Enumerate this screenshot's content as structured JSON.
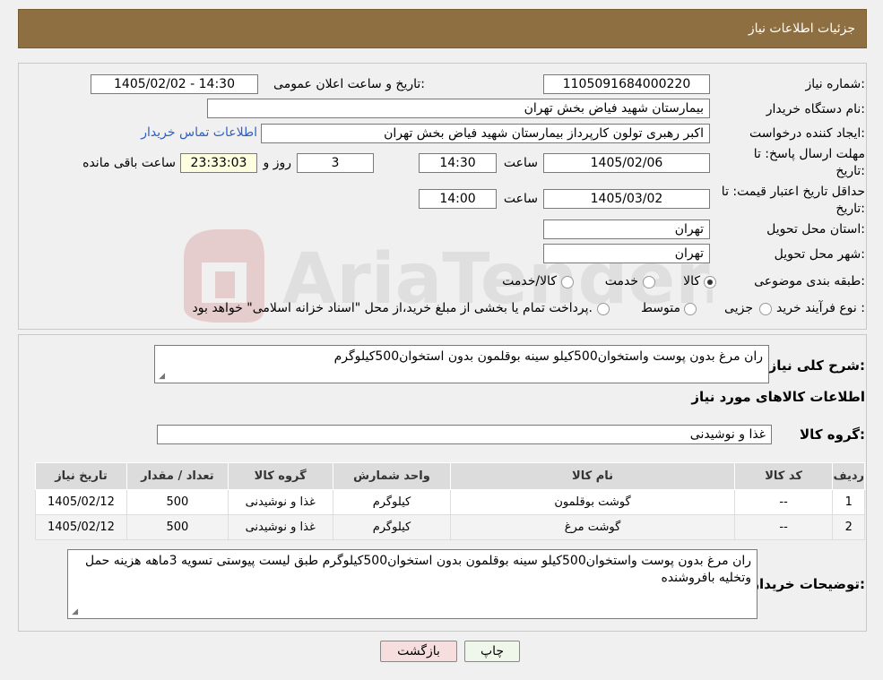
{
  "header": {
    "title": "جزئیات اطلاعات نیاز"
  },
  "form": {
    "need_number_label": "شماره نیاز:",
    "need_number": "1105091684000220",
    "announce_label": "تاریخ و ساعت اعلان عمومی:",
    "announce_value": "1405/02/02 - 14:30",
    "buyer_org_label": "نام دستگاه خریدار:",
    "buyer_org": "بیمارستان شهید فیاض بخش تهران",
    "requester_label": "ایجاد کننده درخواست:",
    "requester": "اکبر رهبری تولون کارپرداز بیمارستان شهید فیاض بخش تهران",
    "contact_link": "اطلاعات تماس خریدار",
    "reply_deadline_label_1": "مهلت ارسال پاسخ: تا",
    "reply_deadline_label_2": "تاریخ:",
    "reply_date": "1405/02/06",
    "time_label": "ساعت",
    "reply_time": "14:30",
    "days_value": "3",
    "days_label": "روز و",
    "remaining_time": "23:33:03",
    "remaining_label": "ساعت باقی مانده",
    "price_validity_label_1": "حداقل تاریخ اعتبار قیمت: تا",
    "price_validity_label_2": "تاریخ:",
    "price_date": "1405/03/02",
    "price_time": "14:00",
    "province_label": "استان محل تحویل:",
    "province": "تهران",
    "city_label": "شهر محل تحویل:",
    "city": "تهران",
    "category_label": "طبقه بندی موضوعی:",
    "category_options": [
      "کالا",
      "خدمت",
      "کالا/خدمت"
    ],
    "category_selected": 0,
    "process_label": "نوع فرآیند خرید :",
    "process_options": [
      "جزیی",
      "متوسط"
    ],
    "process_note": "پرداخت تمام یا بخشی از مبلغ خرید،از محل \"اسناد خزانه اسلامی\" خواهد بود."
  },
  "description": {
    "label": "شرح کلی نیاز:",
    "text": "ران مرغ بدون پوست واستخوان500کیلو سینه بوقلمون بدون استخوان500کیلوگرم"
  },
  "goods": {
    "section_title": "اطلاعات کالاهای مورد نیاز",
    "group_label": "گروه کالا:",
    "group_value": "غذا و نوشیدنی",
    "columns": [
      "ردیف",
      "کد کالا",
      "نام کالا",
      "واحد شمارش",
      "گروه کالا",
      "تعداد / مقدار",
      "تاریخ نیاز"
    ],
    "rows": [
      [
        "1",
        "--",
        "گوشت بوقلمون",
        "کیلوگرم",
        "غذا و نوشیدنی",
        "500",
        "1405/02/12"
      ],
      [
        "2",
        "--",
        "گوشت مرغ",
        "کیلوگرم",
        "غذا و نوشیدنی",
        "500",
        "1405/02/12"
      ]
    ]
  },
  "buyer_notes": {
    "label": "توضیحات خریدار:",
    "text": "ران مرغ بدون پوست واستخوان500کیلو سینه بوقلمون بدون استخوان500کیلوگرم طبق لیست پیوستی تسویه 3ماهه هزینه حمل وتخلیه بافروشنده"
  },
  "buttons": {
    "print": "چاپ",
    "back": "بازگشت"
  },
  "watermark": {
    "text": "AriaTender.neT"
  },
  "colors": {
    "header_bg": "#8e6f41",
    "link": "#2c5fc9",
    "back_button": "#f7dede",
    "print_button": "#eef7e9"
  }
}
